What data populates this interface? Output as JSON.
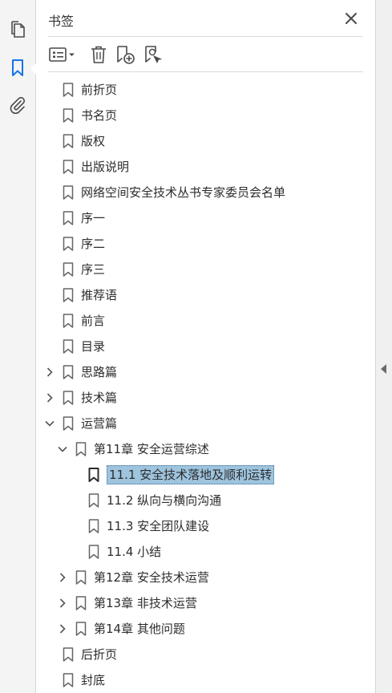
{
  "panel": {
    "title": "书签"
  },
  "rail": {
    "icons": [
      "pages-icon",
      "bookmarks-icon",
      "attachments-icon"
    ],
    "accent_color": "#1473e6"
  },
  "toolbar": {
    "icons": [
      "options-menu-icon",
      "delete-icon",
      "new-bookmark-icon",
      "find-bookmark-icon"
    ]
  },
  "bookmarks": [
    {
      "label": "前折页",
      "level": 0,
      "expander": "none"
    },
    {
      "label": "书名页",
      "level": 0,
      "expander": "none"
    },
    {
      "label": "版权",
      "level": 0,
      "expander": "none"
    },
    {
      "label": "出版说明",
      "level": 0,
      "expander": "none"
    },
    {
      "label": "网络空间安全技术丛书专家委员会名单",
      "level": 0,
      "expander": "none"
    },
    {
      "label": "序一",
      "level": 0,
      "expander": "none"
    },
    {
      "label": "序二",
      "level": 0,
      "expander": "none"
    },
    {
      "label": "序三",
      "level": 0,
      "expander": "none"
    },
    {
      "label": "推荐语",
      "level": 0,
      "expander": "none"
    },
    {
      "label": "前言",
      "level": 0,
      "expander": "none"
    },
    {
      "label": "目录",
      "level": 0,
      "expander": "none"
    },
    {
      "label": "思路篇",
      "level": 0,
      "expander": "collapsed"
    },
    {
      "label": "技术篇",
      "level": 0,
      "expander": "collapsed"
    },
    {
      "label": "运营篇",
      "level": 0,
      "expander": "expanded"
    },
    {
      "label": "第11章 安全运营综述",
      "level": 1,
      "expander": "expanded"
    },
    {
      "label": "11.1 安全技术落地及顺利运转",
      "level": 2,
      "expander": "none",
      "selected": true
    },
    {
      "label": "11.2 纵向与横向沟通",
      "level": 2,
      "expander": "none"
    },
    {
      "label": "11.3 安全团队建设",
      "level": 2,
      "expander": "none"
    },
    {
      "label": "11.4 小结",
      "level": 2,
      "expander": "none"
    },
    {
      "label": "第12章 安全技术运营",
      "level": 1,
      "expander": "collapsed"
    },
    {
      "label": "第13章 非技术运营",
      "level": 1,
      "expander": "collapsed"
    },
    {
      "label": "第14章 其他问题",
      "level": 1,
      "expander": "collapsed"
    },
    {
      "label": "后折页",
      "level": 0,
      "expander": "none"
    },
    {
      "label": "封底",
      "level": 0,
      "expander": "none"
    }
  ]
}
